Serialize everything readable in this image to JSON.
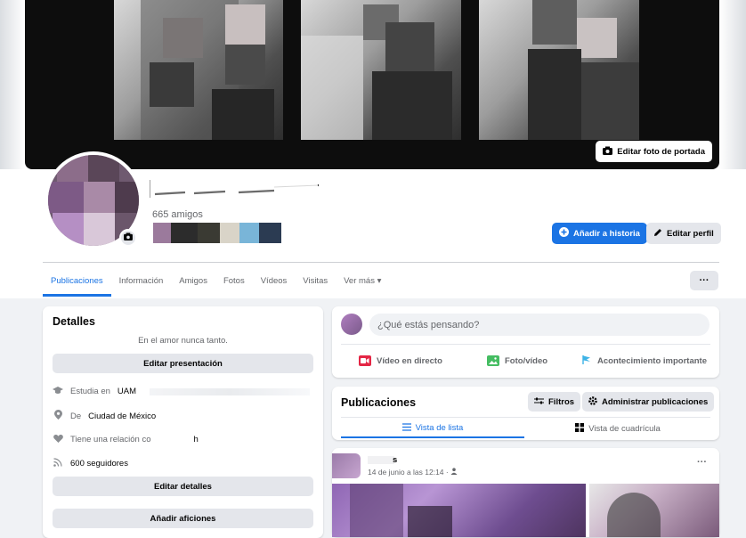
{
  "cover": {
    "edit_label": "Editar foto de portada",
    "edit_icon": "camera-icon"
  },
  "profile": {
    "friends_count": "665 amigos",
    "add_story_label": "Añadir a historia",
    "edit_profile_label": "Editar perfil",
    "more_label": "···"
  },
  "tabs": [
    {
      "label": "Publicaciones",
      "active": true
    },
    {
      "label": "Información"
    },
    {
      "label": "Amigos"
    },
    {
      "label": "Fotos"
    },
    {
      "label": "Vídeos"
    },
    {
      "label": "Visitas"
    },
    {
      "label": "Ver más ▾"
    }
  ],
  "details": {
    "title": "Detalles",
    "bio": "En el amor nunca tanto.",
    "edit_bio_label": "Editar presentación",
    "study_prefix": "Estudia en",
    "study_value": "UAM",
    "location_prefix": "De",
    "location_value": "Ciudad de México",
    "relationship_text": "Tiene una relación co",
    "relationship_tail": "h",
    "followers": "600 seguidores",
    "edit_details_label": "Editar detalles",
    "add_hobbies_label": "Añadir aficiones"
  },
  "composer": {
    "placeholder": "¿Qué estás pensando?",
    "live_label": "Vídeo en directo",
    "photo_label": "Foto/vídeo",
    "event_label": "Acontecimiento importante"
  },
  "posts": {
    "title": "Publicaciones",
    "filters_label": "Filtros",
    "manage_label": "Administrar publicaciones",
    "list_view_label": "Vista de lista",
    "grid_view_label": "Vista de cuadrícula"
  },
  "post": {
    "name_fragment": "s",
    "time": "14 de junio a las 12:14 · ",
    "more": "···"
  },
  "colors": {
    "accent": "#1b74e4",
    "background": "#f0f2f5",
    "live_red": "#e42645",
    "photo_green": "#45bd62",
    "event_blue": "#3eb3e6"
  }
}
